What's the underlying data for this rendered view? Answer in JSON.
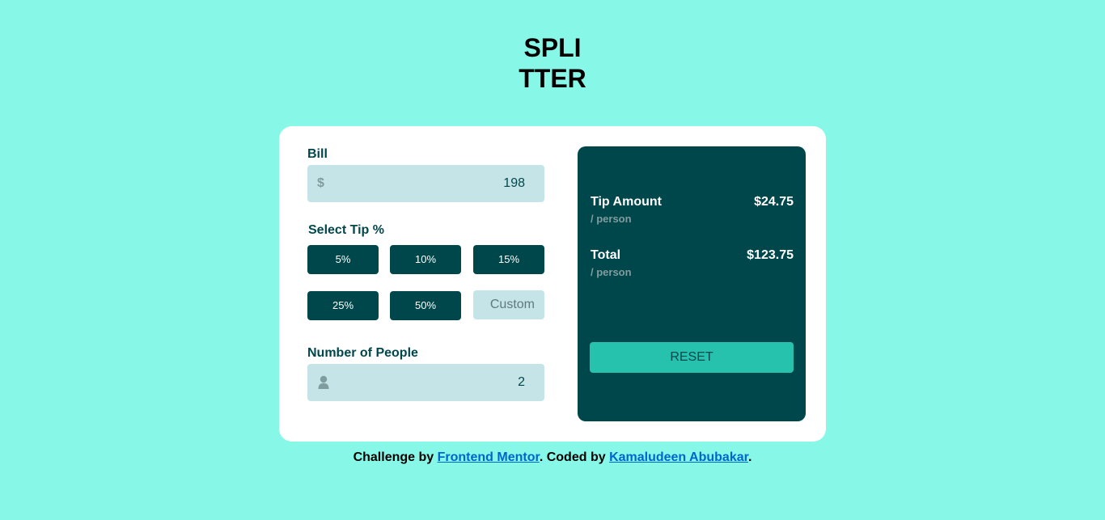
{
  "header": {
    "title_line1": "SPLI",
    "title_line2": "TTER"
  },
  "form": {
    "bill_label": "Bill",
    "bill_prefix": "$",
    "bill_value": "198",
    "tip_label": "Select Tip %",
    "tips": [
      "5%",
      "10%",
      "15%",
      "25%",
      "50%"
    ],
    "custom_placeholder": "Custom",
    "people_label": "Number of People",
    "people_icon": "person-icon",
    "people_value": "2"
  },
  "results": {
    "tip_label": "Tip Amount",
    "tip_sub": "/ person",
    "tip_value": "$24.75",
    "total_label": "Total",
    "total_sub": "/ person",
    "total_value": "$123.75",
    "reset_label": "RESET"
  },
  "footer": {
    "prefix": "Challenge by ",
    "link1": "Frontend Mentor",
    "middle": ". Coded by ",
    "link2": "Kamaludeen Abubakar",
    "suffix": "."
  },
  "colors": {
    "background": "#87f8e8",
    "dark_teal": "#00474b",
    "light_field": "#c5e4e7",
    "accent": "#26c2ad",
    "muted": "#7f9d9f",
    "link": "#0066cc"
  }
}
